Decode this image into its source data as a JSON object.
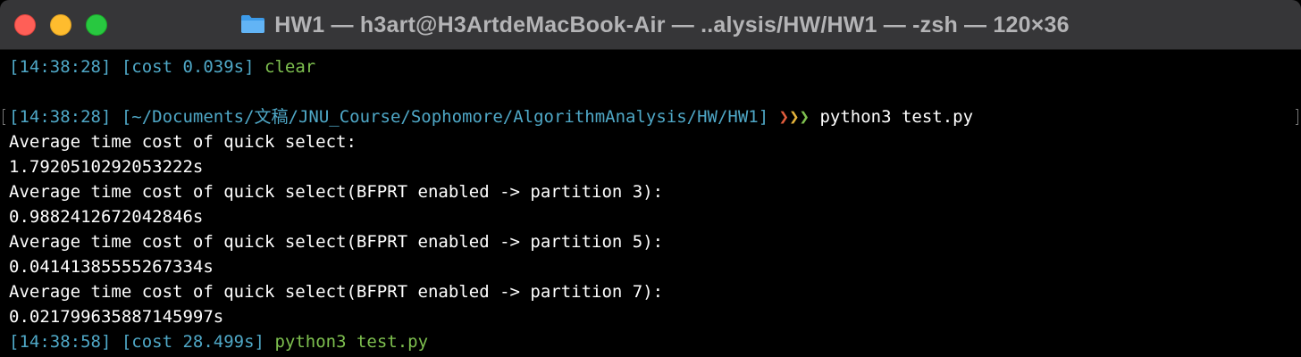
{
  "window": {
    "title": "HW1 — h3art@H3ArtdeMacBook-Air — ..alysis/HW/HW1 — -zsh — 120×36",
    "folder_icon": "folder-icon",
    "colors": {
      "titlebar": "#363638",
      "background": "#000000",
      "close": "#ff5f57",
      "minimize": "#febc2e",
      "zoom": "#28c840",
      "prompt_blue": "#4fa8c7",
      "command_green": "#7ec04f"
    }
  },
  "terminal": {
    "line1": {
      "time": "[14:38:28]",
      "cost": "[cost 0.039s]",
      "cmd": "clear"
    },
    "line3": {
      "time": "[14:38:28]",
      "path": "[~/Documents/文稿/JNU_Course/Sophomore/AlgorithmAnalysis/HW/HW1]",
      "arrows": [
        "❯",
        "❯",
        "❯"
      ],
      "cmd": "python3 test.py"
    },
    "output": [
      "Average time cost of quick select:",
      "1.7920510292053222s",
      "Average time cost of quick select(BFPRT enabled -> partition 3):",
      "0.9882412672042846s",
      "Average time cost of quick select(BFPRT enabled -> partition 5):",
      "0.04141385555267334s",
      "Average time cost of quick select(BFPRT enabled -> partition 7):",
      "0.021799635887145997s"
    ],
    "last": {
      "time": "[14:38:58]",
      "cost": "[cost 28.499s]",
      "cmd": "python3 test.py"
    }
  }
}
